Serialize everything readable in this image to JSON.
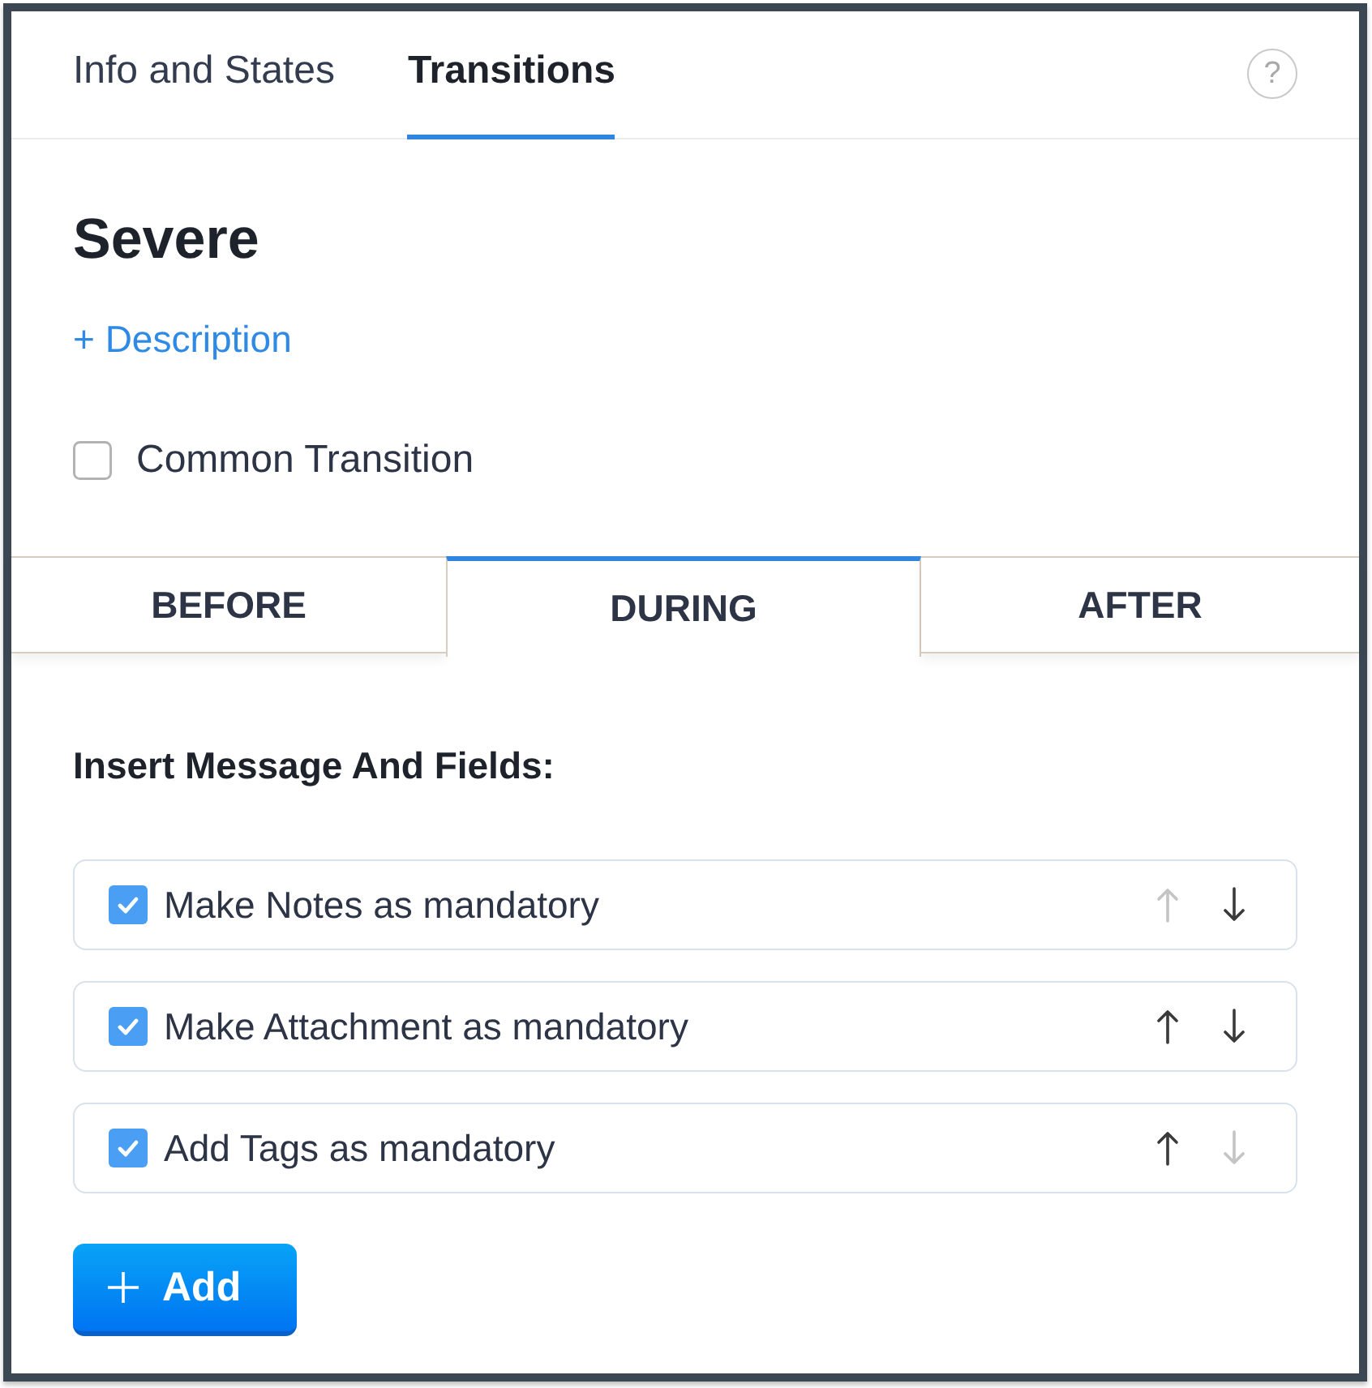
{
  "header_tabs": [
    {
      "label": "Info and States",
      "selected": false
    },
    {
      "label": "Transitions",
      "selected": true
    }
  ],
  "help_button": "?",
  "state": {
    "title": "Severe",
    "description_link": "+ Description",
    "common_transition": {
      "label": "Common Transition",
      "checked": false
    }
  },
  "phase_tabs": [
    {
      "label": "BEFORE",
      "selected": false
    },
    {
      "label": "DURING",
      "selected": true
    },
    {
      "label": "AFTER",
      "selected": false
    }
  ],
  "section": {
    "heading": "Insert Message And Fields:",
    "rows": [
      {
        "label": "Make Notes as mandatory",
        "checked": true,
        "move_up_disabled": true,
        "move_down_disabled": false
      },
      {
        "label": "Make Attachment as mandatory",
        "checked": true,
        "move_up_disabled": false,
        "move_down_disabled": false
      },
      {
        "label": "Add Tags as mandatory",
        "checked": true,
        "move_up_disabled": false,
        "move_down_disabled": true
      }
    ]
  },
  "add_button": {
    "label": "Add"
  }
}
